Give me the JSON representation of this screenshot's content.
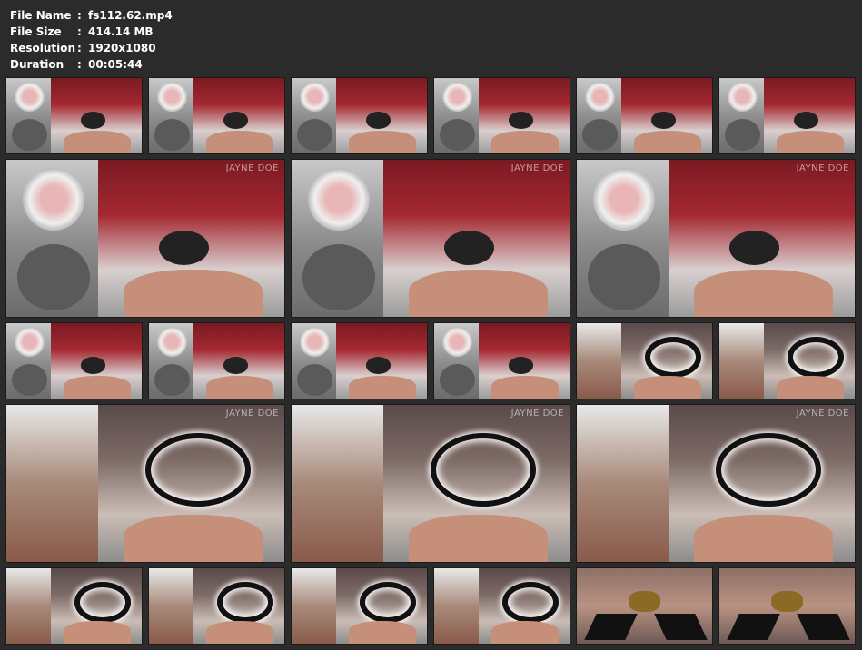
{
  "file_info": [
    {
      "label": "File Name",
      "value": "fs112.62.mp4"
    },
    {
      "label": "File Size",
      "value": "414.14 MB"
    },
    {
      "label": "Resolution",
      "value": "1920x1080"
    },
    {
      "label": "Duration",
      "value": "00:05:44"
    }
  ],
  "separator": ":",
  "watermark": "JAYNE DOE"
}
